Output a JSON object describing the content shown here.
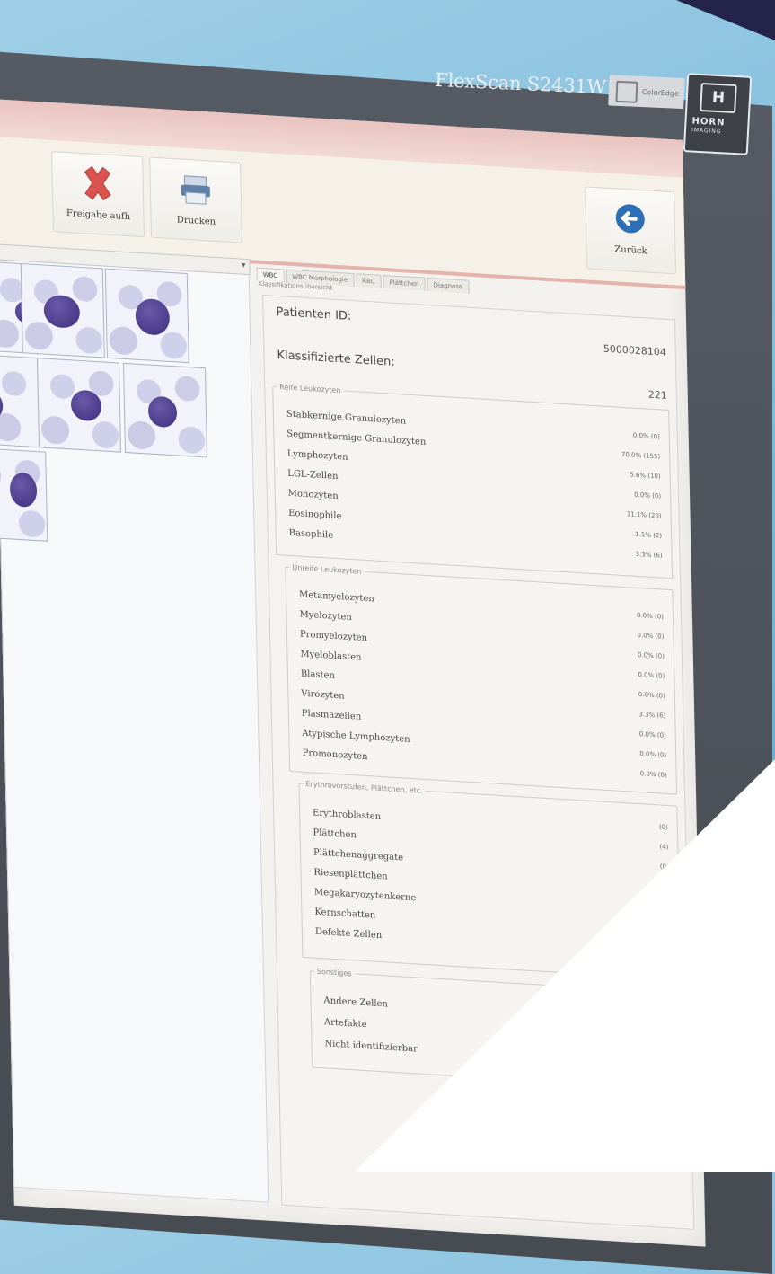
{
  "monitor": {
    "model": "FlexScan S2431W",
    "badge_text": "ColorEdge",
    "logo_letter": "H",
    "logo_name": "HORN",
    "logo_sub": "IMAGING"
  },
  "toolbar": {
    "freigabe_label": "Freigabe aufh",
    "drucken_label": "Drucken",
    "zurueck_label": "Zurück"
  },
  "tabs": [
    "WBC",
    "WBC Morphologie",
    "RBC",
    "Plättchen",
    "Diagnose"
  ],
  "classification_heading": "Klassifikationsübersicht",
  "patient": {
    "id_label": "Patienten ID:",
    "id_value": "5000028104",
    "classified_label": "Klassifizierte Zellen:",
    "classified_value": "221"
  },
  "groups": {
    "mature": {
      "title": "Reife Leukozyten",
      "items": [
        {
          "name": "Stabkernige Granulozyten",
          "value": "0.0% (0)"
        },
        {
          "name": "Segmentkernige Granulozyten",
          "value": "70.0% (155)"
        },
        {
          "name": "Lymphozyten",
          "value": "5.6% (10)"
        },
        {
          "name": "LGL-Zellen",
          "value": "0.0% (0)"
        },
        {
          "name": "Monozyten",
          "value": "11.1% (20)"
        },
        {
          "name": "Eosinophile",
          "value": "1.1% (2)"
        },
        {
          "name": "Basophile",
          "value": "3.3% (6)"
        }
      ]
    },
    "immature": {
      "title": "Unreife Leukozyten",
      "items": [
        {
          "name": "Metamyelozyten",
          "value": "0.0% (0)"
        },
        {
          "name": "Myelozyten",
          "value": "0.0% (0)"
        },
        {
          "name": "Promyelozyten",
          "value": "0.0% (0)"
        },
        {
          "name": "Myeloblasten",
          "value": "0.0% (0)"
        },
        {
          "name": "Blasten",
          "value": "0.0% (0)"
        },
        {
          "name": "Virozyten",
          "value": "3.3% (6)"
        },
        {
          "name": "Plasmazellen",
          "value": "0.0% (0)"
        },
        {
          "name": "Atypische Lymphozyten",
          "value": "0.0% (0)"
        },
        {
          "name": "Promonozyten",
          "value": "0.0% (0)"
        }
      ]
    },
    "erythro": {
      "title": "Erythrovorstufen, Plättchen, etc.",
      "items": [
        {
          "name": "Erythroblasten",
          "value": "(0)"
        },
        {
          "name": "Plättchen",
          "value": "(4)"
        },
        {
          "name": "Plättchenaggregate",
          "value": "(0)"
        },
        {
          "name": "Riesenplättchen",
          "value": ""
        },
        {
          "name": "Megakaryozytenkerne",
          "value": ""
        },
        {
          "name": "Kernschatten",
          "value": ""
        },
        {
          "name": "Defekte Zellen",
          "value": ""
        }
      ]
    },
    "other": {
      "title": "Sonstiges",
      "items": [
        {
          "name": "Andere Zellen",
          "value": ""
        },
        {
          "name": "Artefakte",
          "value": ""
        },
        {
          "name": "Nicht identifizierbar",
          "value": ""
        }
      ]
    }
  },
  "colors": {
    "accent_pink": "#e4b3ac",
    "delete_red": "#d9534f",
    "back_blue": "#2f6fb5",
    "nucleus_purple": "#4b3a8f"
  }
}
